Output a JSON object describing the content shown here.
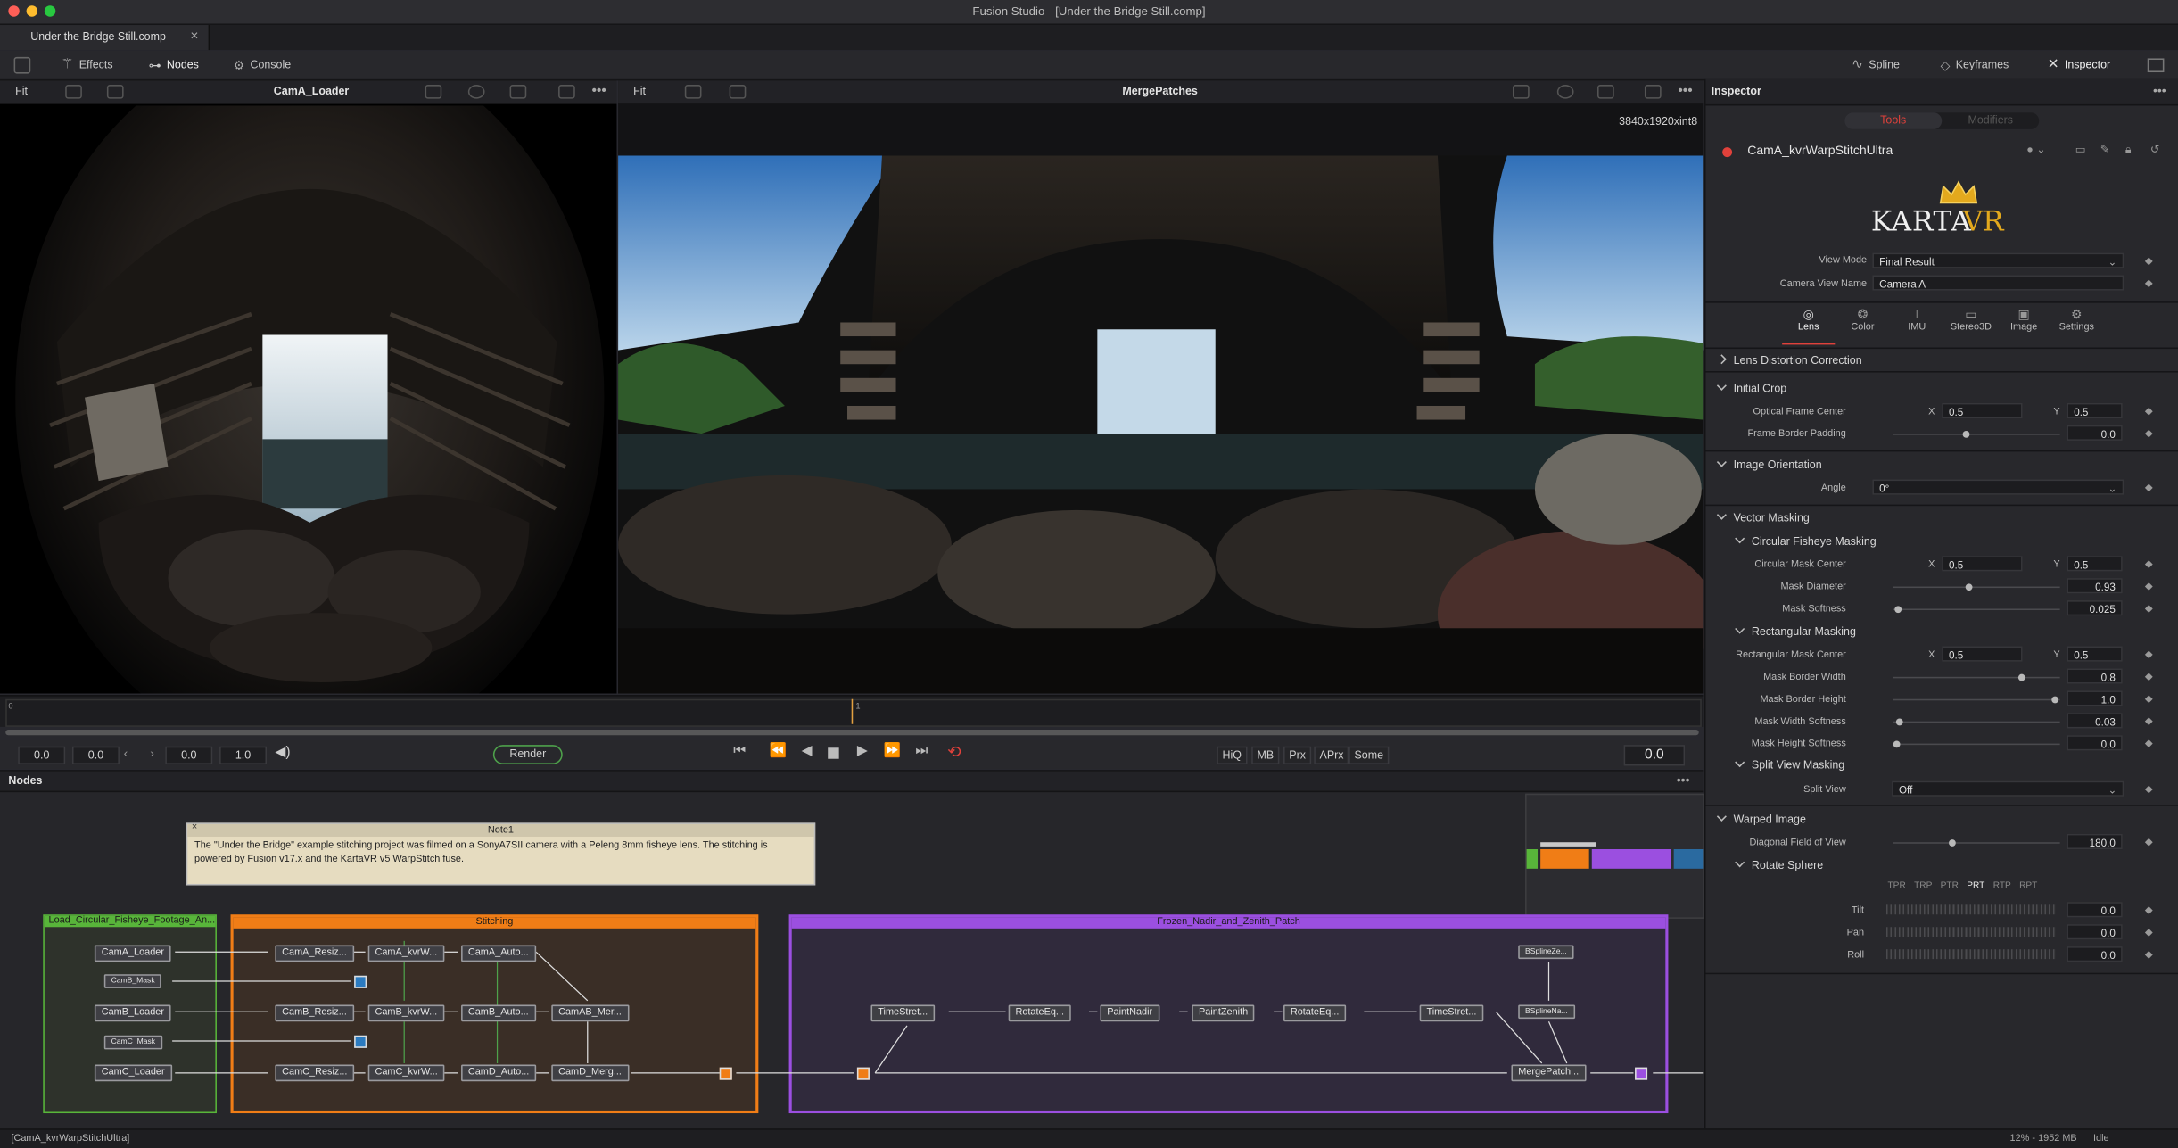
{
  "window": {
    "title": "Fusion Studio - [Under the Bridge Still.comp]"
  },
  "tab": {
    "label": "Under the Bridge Still.comp",
    "close": "×"
  },
  "toolbar": {
    "effects": "Effects",
    "nodes": "Nodes",
    "console": "Console",
    "spline": "Spline",
    "keyframes": "Keyframes",
    "inspector": "Inspector"
  },
  "viewer_left": {
    "fit": "Fit",
    "title": "CamA_Loader"
  },
  "viewer_right": {
    "fit": "Fit",
    "title": "MergePatches",
    "resolution": "3840x1920xint8"
  },
  "timeline": {
    "start_marker": "0",
    "playhead_marker": "1"
  },
  "transport": {
    "f1": "0.0",
    "f2": "0.0",
    "f3": "0.0",
    "f4": "1.0",
    "render": "Render",
    "hiq": "HiQ",
    "mb": "MB",
    "prx": "Prx",
    "aprx": "APrx",
    "some": "Some",
    "current": "0.0"
  },
  "nodes_panel": {
    "title": "Nodes",
    "note_title": "Note1",
    "note_text": "The \"Under the Bridge\" example stitching project was filmed on a SonyA7SII camera with a Peleng 8mm fisheye lens. The stitching is powered by Fusion v17.x and the KartaVR v5 WarpStitch fuse."
  },
  "groups": {
    "load": "Load_Circular_Fisheye_Footage_An...",
    "stitching": "Stitching",
    "frozen": "Frozen_Nadir_and_Zenith_Patch"
  },
  "nodes": {
    "camA_loader": "CamA_Loader",
    "camB_mask": "CamB_Mask",
    "camB_loader": "CamB_Loader",
    "camC_mask": "CamC_Mask",
    "camC_loader": "CamC_Loader",
    "camA_resize": "CamA_Resiz...",
    "camA_kvr": "CamA_kvrW...",
    "camA_auto": "CamA_Auto...",
    "camB_resize": "CamB_Resiz...",
    "camB_kvr": "CamB_kvrW...",
    "camB_auto": "CamB_Auto...",
    "camAB_merge": "CamAB_Mer...",
    "camC_resize": "CamC_Resiz...",
    "camC_kvr": "CamC_kvrW...",
    "camD_auto": "CamD_Auto...",
    "camD_merge": "CamD_Merg...",
    "timestretch1": "TimeStret...",
    "rotateeq1": "RotateEq...",
    "paintnadir": "PaintNadir",
    "paintzenith": "PaintZenith",
    "rotateeq2": "RotateEq...",
    "timestretch2": "TimeStret...",
    "bspline1": "BSplineZe...",
    "bspline2": "BSplineNa...",
    "mergepatch": "MergePatch..."
  },
  "inspector": {
    "title": "Inspector",
    "tab_tools": "Tools",
    "tab_modifiers": "Modifiers",
    "tool_name": "CamA_kvrWarpStitchUltra",
    "logo_text_1": "KARTA",
    "logo_text_2": "VR",
    "view_mode_label": "View Mode",
    "view_mode": "Final Result",
    "camera_view_label": "Camera View Name",
    "camera_view": "Camera A",
    "subtabs": [
      "Lens",
      "Color",
      "IMU",
      "Stereo3D",
      "Image",
      "Settings"
    ],
    "lens_distortion": "Lens Distortion Correction",
    "initial_crop": "Initial Crop",
    "optical_center": "Optical Frame Center",
    "optical_x": "0.5",
    "optical_y": "0.5",
    "frame_padding": "Frame Border Padding",
    "frame_padding_v": "0.0",
    "image_orientation": "Image Orientation",
    "angle_label": "Angle",
    "angle": "0°",
    "vector_masking": "Vector Masking",
    "circ_fisheye": "Circular Fisheye Masking",
    "circ_center": "Circular Mask Center",
    "circ_x": "0.5",
    "circ_y": "0.5",
    "mask_diam": "Mask Diameter",
    "mask_diam_v": "0.93",
    "mask_soft": "Mask Softness",
    "mask_soft_v": "0.025",
    "rect_masking": "Rectangular Masking",
    "rect_center": "Rectangular Mask Center",
    "rect_x": "0.5",
    "rect_y": "0.5",
    "border_w": "Mask Border Width",
    "border_w_v": "0.8",
    "border_h": "Mask Border Height",
    "border_h_v": "1.0",
    "width_soft": "Mask Width Softness",
    "width_soft_v": "0.03",
    "height_soft": "Mask Height Softness",
    "height_soft_v": "0.0",
    "split_view_masking": "Split View Masking",
    "split_view": "Split View",
    "split_view_v": "Off",
    "warped_image": "Warped Image",
    "dfov": "Diagonal Field of View",
    "dfov_v": "180.0",
    "rotate_sphere": "Rotate Sphere",
    "rot_orders": [
      "TPR",
      "TRP",
      "PTR",
      "PRT",
      "RTP",
      "RPT"
    ],
    "tilt": "Tilt",
    "tilt_v": "0.0",
    "pan": "Pan",
    "pan_v": "0.0",
    "roll": "Roll",
    "roll_v": "0.0",
    "x": "X",
    "y": "Y"
  },
  "statusbar": {
    "left": "[CamA_kvrWarpStitchUltra]",
    "mem": "12% - 1952 MB",
    "state": "Idle"
  },
  "colors": {
    "accent_red": "#e0413b",
    "stitch_orange": "#f07d16",
    "frozen_purple": "#9b4fe0",
    "load_green": "#58b53a"
  }
}
